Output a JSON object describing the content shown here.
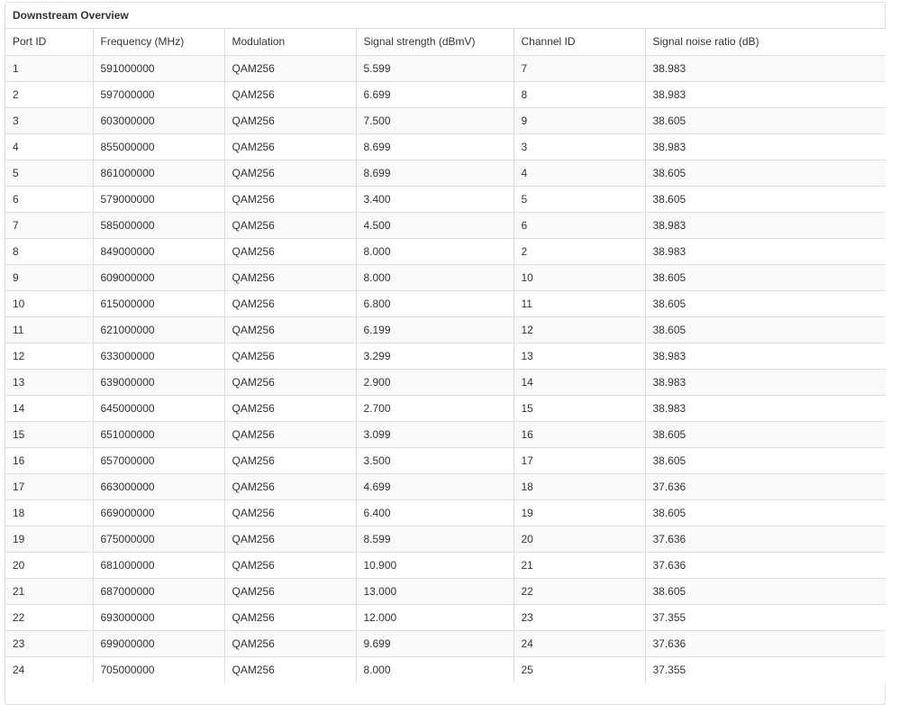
{
  "panel": {
    "title": "Downstream Overview"
  },
  "table": {
    "columns": [
      "Port ID",
      "Frequency (MHz)",
      "Modulation",
      "Signal strength (dBmV)",
      "Channel ID",
      "Signal noise ratio (dB)"
    ],
    "rows": [
      [
        "1",
        "591000000",
        "QAM256",
        "5.599",
        "7",
        "38.983"
      ],
      [
        "2",
        "597000000",
        "QAM256",
        "6.699",
        "8",
        "38.983"
      ],
      [
        "3",
        "603000000",
        "QAM256",
        "7.500",
        "9",
        "38.605"
      ],
      [
        "4",
        "855000000",
        "QAM256",
        "8.699",
        "3",
        "38.983"
      ],
      [
        "5",
        "861000000",
        "QAM256",
        "8.699",
        "4",
        "38.605"
      ],
      [
        "6",
        "579000000",
        "QAM256",
        "3.400",
        "5",
        "38.605"
      ],
      [
        "7",
        "585000000",
        "QAM256",
        "4.500",
        "6",
        "38.983"
      ],
      [
        "8",
        "849000000",
        "QAM256",
        "8.000",
        "2",
        "38.983"
      ],
      [
        "9",
        "609000000",
        "QAM256",
        "8.000",
        "10",
        "38.605"
      ],
      [
        "10",
        "615000000",
        "QAM256",
        "6.800",
        "11",
        "38.605"
      ],
      [
        "11",
        "621000000",
        "QAM256",
        "6.199",
        "12",
        "38.605"
      ],
      [
        "12",
        "633000000",
        "QAM256",
        "3.299",
        "13",
        "38.983"
      ],
      [
        "13",
        "639000000",
        "QAM256",
        "2.900",
        "14",
        "38.983"
      ],
      [
        "14",
        "645000000",
        "QAM256",
        "2.700",
        "15",
        "38.983"
      ],
      [
        "15",
        "651000000",
        "QAM256",
        "3.099",
        "16",
        "38.605"
      ],
      [
        "16",
        "657000000",
        "QAM256",
        "3.500",
        "17",
        "38.605"
      ],
      [
        "17",
        "663000000",
        "QAM256",
        "4.699",
        "18",
        "37.636"
      ],
      [
        "18",
        "669000000",
        "QAM256",
        "6.400",
        "19",
        "38.605"
      ],
      [
        "19",
        "675000000",
        "QAM256",
        "8.599",
        "20",
        "37.636"
      ],
      [
        "20",
        "681000000",
        "QAM256",
        "10.900",
        "21",
        "37.636"
      ],
      [
        "21",
        "687000000",
        "QAM256",
        "13.000",
        "22",
        "38.605"
      ],
      [
        "22",
        "693000000",
        "QAM256",
        "12.000",
        "23",
        "37.355"
      ],
      [
        "23",
        "699000000",
        "QAM256",
        "9.699",
        "24",
        "37.636"
      ],
      [
        "24",
        "705000000",
        "QAM256",
        "8.000",
        "25",
        "37.355"
      ]
    ]
  }
}
